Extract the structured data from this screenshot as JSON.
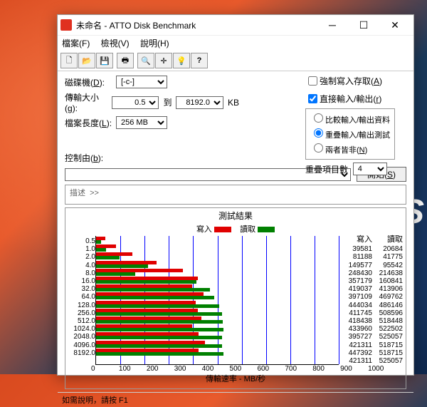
{
  "window": {
    "title": "未命名 - ATTO Disk Benchmark"
  },
  "menu": {
    "file": "檔案(F)",
    "view": "檢視(V)",
    "help": "說明(H)"
  },
  "form": {
    "drive_label": "磁碟機",
    "drive_value": "[-c-]",
    "size_label": "傳輸大小",
    "size_from": "0.5",
    "to_label": "到",
    "size_to": "8192.0",
    "kb": "KB",
    "length_label": "檔案長度",
    "length_value": "256 MB",
    "force_write": "強制寫入存取",
    "direct_io": "直接輸入/輸出",
    "mode_compare": "比較輸入/輸出資料",
    "mode_overlap": "重疊輸入/輸出測試",
    "mode_neither": "兩者皆非",
    "queue_label": "重疊項目數",
    "queue_value": "4",
    "control_label": "控制由",
    "start_btn": "開始",
    "desc_label": "描述"
  },
  "results": {
    "title": "測試結果",
    "write_label": "寫入",
    "read_label": "讀取",
    "x_title": "傳輸速率 - MB/秒"
  },
  "status": "如需說明，請按 F1",
  "chart_data": {
    "type": "bar",
    "xlabel": "傳輸速率 - MB/秒",
    "xlim": [
      0,
      1000
    ],
    "x_ticks": [
      0,
      100,
      200,
      300,
      400,
      500,
      600,
      700,
      800,
      900,
      1000
    ],
    "categories": [
      "0.5",
      "1.0",
      "2.0",
      "4.0",
      "8.0",
      "16.0",
      "32.0",
      "64.0",
      "128.0",
      "256.0",
      "512.0",
      "1024.0",
      "2048.0",
      "4096.0",
      "8192.0"
    ],
    "series": [
      {
        "name": "寫入",
        "color": "#e00000",
        "values": [
          39581,
          81188,
          149577,
          248430,
          357179,
          419037,
          397109,
          444034,
          411745,
          418438,
          433960,
          395727,
          421311,
          447392,
          421311
        ]
      },
      {
        "name": "讀取",
        "color": "#008000",
        "values": [
          20684,
          41775,
          95542,
          214638,
          160841,
          413906,
          469762,
          486146,
          508596,
          518448,
          522502,
          525057,
          518715,
          518715,
          525057
        ]
      }
    ],
    "display_scale": 1000
  }
}
